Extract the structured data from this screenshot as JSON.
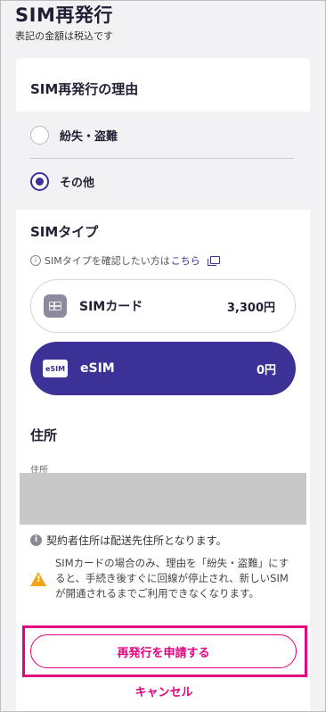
{
  "header": {
    "title": "SIM再発行",
    "subtitle": "表記の金額は税込です"
  },
  "reason": {
    "section_title": "SIM再発行の理由",
    "options": [
      {
        "label": "紛失・盗難",
        "selected": false
      },
      {
        "label": "その他",
        "selected": true
      }
    ]
  },
  "sim_type": {
    "section_title": "SIMタイプ",
    "info_text": "SIMタイプを確認したい方は",
    "info_link": "こちら",
    "options": [
      {
        "name": "SIMカード",
        "price": "3,300円",
        "icon": "sim-card-icon",
        "selected": false
      },
      {
        "name": "eSIM",
        "price": "0円",
        "icon": "esim-icon",
        "icon_text": "eSIM",
        "selected": true
      }
    ]
  },
  "address": {
    "section_title": "住所",
    "field_label": "住所",
    "note": "契約者住所は配送先住所となります。"
  },
  "warning": {
    "text": "SIMカードの場合のみ、理由を「紛失・盗難」にすると、手続き後すぐに回線が停止され、新しいSIMが開通されるまでご利用できなくなります。"
  },
  "actions": {
    "submit_label": "再発行を申請する",
    "cancel_label": "キャンセル"
  },
  "colors": {
    "accent": "#3b3196",
    "magenta": "#e4007f",
    "warning": "#f2a414"
  }
}
